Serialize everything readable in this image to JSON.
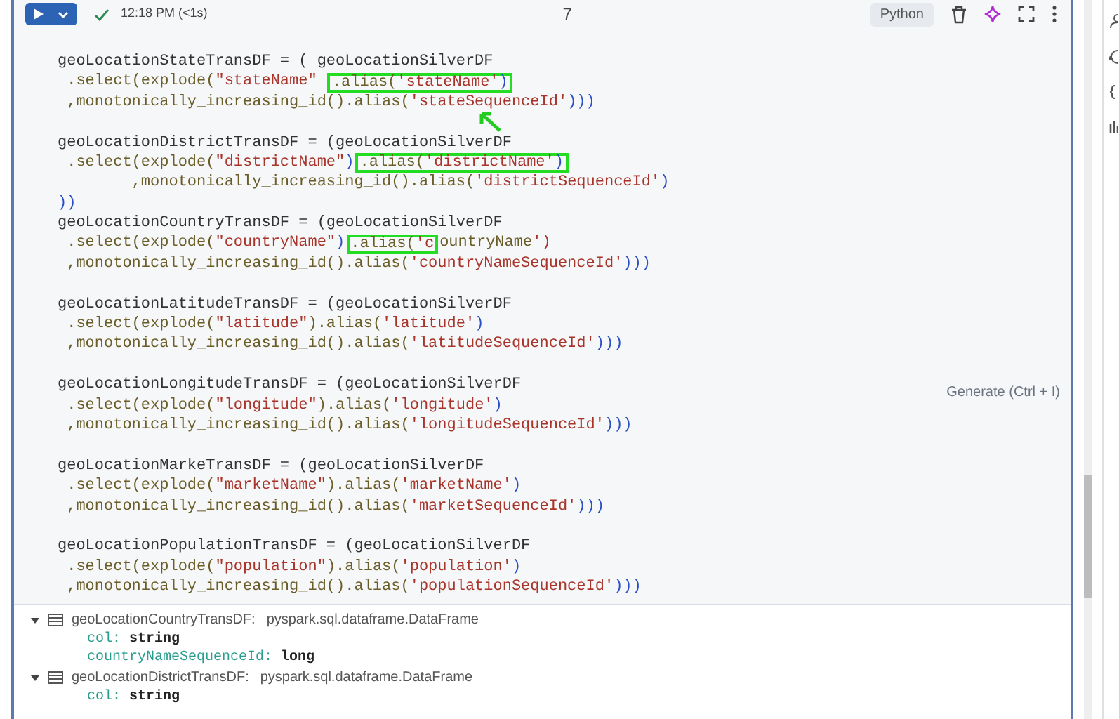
{
  "cell_toolbar": {
    "run_time": "12:18 PM (<1s)",
    "cell_number": "7",
    "language": "Python",
    "succeeded": true
  },
  "code_blocks": [
    {
      "lines": [
        {
          "parts": [
            {
              "text": "geoLocationStateTransDF = ( geoLocationSilverDF",
              "boxed": false
            }
          ]
        },
        {
          "parts": [
            {
              "text": " .select(explode(\"stateName\" ",
              "boxed": false
            },
            {
              "text": ".alias('stateName')",
              "boxed": true
            }
          ]
        },
        {
          "parts": [
            {
              "text": " ,monotonically_increasing_id().alias('stateSequenceId')))",
              "boxed": false
            }
          ],
          "arrow": true
        }
      ]
    },
    {
      "lines": [
        {
          "parts": [
            {
              "text": "geoLocationDistrictTransDF = (geoLocationSilverDF",
              "boxed": false
            }
          ]
        },
        {
          "parts": [
            {
              "text": " .select(explode(\"districtName\")",
              "boxed": false
            },
            {
              "text": ".alias('districtName')",
              "boxed": true
            }
          ]
        },
        {
          "parts": [
            {
              "text": "        ,monotonically_increasing_id().alias('districtSequenceId')",
              "boxed": false
            }
          ]
        },
        {
          "parts": [
            {
              "text": "))",
              "boxed": false
            }
          ]
        },
        {
          "parts": [
            {
              "text": "geoLocationCountryTransDF = (geoLocationSilverDF",
              "boxed": false
            }
          ]
        },
        {
          "parts": [
            {
              "text": " .select(explode(\"countryName\")",
              "boxed": false
            },
            {
              "text": ".alias('c",
              "boxed": true
            },
            {
              "text": "ountryName')",
              "boxed": false
            }
          ]
        },
        {
          "parts": [
            {
              "text": " ,monotonically_increasing_id().alias('countryNameSequenceId')))",
              "boxed": false
            }
          ]
        }
      ]
    },
    {
      "lines": [
        {
          "parts": [
            {
              "text": "geoLocationLatitudeTransDF = (geoLocationSilverDF",
              "boxed": false
            }
          ]
        },
        {
          "parts": [
            {
              "text": " .select(explode(\"latitude\").alias('latitude')",
              "boxed": false
            }
          ]
        },
        {
          "parts": [
            {
              "text": " ,monotonically_increasing_id().alias('latitudeSequenceId')))",
              "boxed": false
            }
          ]
        }
      ]
    },
    {
      "lines": [
        {
          "parts": [
            {
              "text": "geoLocationLongitudeTransDF = (geoLocationSilverDF",
              "boxed": false
            }
          ]
        },
        {
          "parts": [
            {
              "text": " .select(explode(\"longitude\").alias('longitude')",
              "boxed": false
            }
          ]
        },
        {
          "parts": [
            {
              "text": " ,monotonically_increasing_id().alias('longitudeSequenceId')))",
              "boxed": false
            }
          ]
        }
      ]
    },
    {
      "lines": [
        {
          "parts": [
            {
              "text": "geoLocationMarkeTransDF = (geoLocationSilverDF",
              "boxed": false
            }
          ]
        },
        {
          "parts": [
            {
              "text": " .select(explode(\"marketName\").alias('marketName')",
              "boxed": false
            }
          ]
        },
        {
          "parts": [
            {
              "text": " ,monotonically_increasing_id().alias('marketSequenceId')))",
              "boxed": false
            }
          ]
        }
      ]
    },
    {
      "lines": [
        {
          "parts": [
            {
              "text": "geoLocationPopulationTransDF = (geoLocationSilverDF",
              "boxed": false
            }
          ]
        },
        {
          "parts": [
            {
              "text": " .select(explode(\"population\").alias('population')",
              "boxed": false
            }
          ]
        },
        {
          "parts": [
            {
              "text": " ,monotonically_increasing_id().alias('populationSequenceId')))",
              "boxed": false
            }
          ]
        }
      ]
    }
  ],
  "generate_hint": "Generate (Ctrl + I)",
  "outputs": [
    {
      "name": "geoLocationCountryTransDF:",
      "type": "pyspark.sql.dataframe.DataFrame",
      "expanded": true,
      "fields": [
        {
          "name": "col:",
          "type": "string"
        },
        {
          "name": "countryNameSequenceId:",
          "type": "long"
        }
      ]
    },
    {
      "name": "geoLocationDistrictTransDF:",
      "type": "pyspark.sql.dataframe.DataFrame",
      "expanded": true,
      "fields": [
        {
          "name": "col:",
          "type": "string"
        }
      ]
    }
  ]
}
